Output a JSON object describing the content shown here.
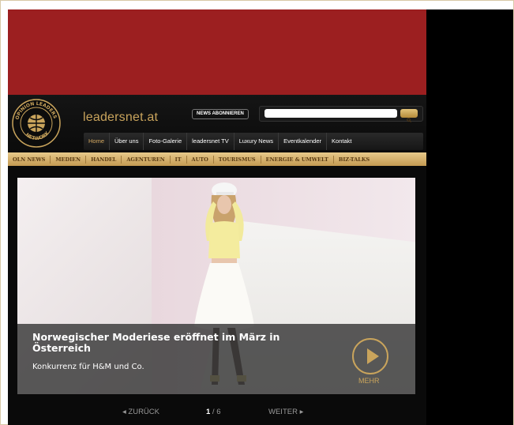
{
  "header": {
    "site_name": "leadersnet.at",
    "news_button": "NEWS ABONNIEREN",
    "search": {
      "value": ""
    },
    "logo": {
      "top_text": "OPINION LEADERS",
      "bottom_text": "NETWORK"
    }
  },
  "mainnav": [
    "Home",
    "Über uns",
    "Foto-Galerie",
    "leadersnet TV",
    "Luxury News",
    "Eventkalender",
    "Kontakt"
  ],
  "categories": [
    "OLN NEWS",
    "MEDIEN",
    "HANDEL",
    "AGENTUREN",
    "IT",
    "AUTO",
    "TOURISMUS",
    "ENERGIE & UMWELT",
    "BIZ-TALKS"
  ],
  "slide": {
    "title": "Norwegischer Moderiese eröffnet im März in Österreich",
    "subtitle": "Konkurrenz für H&M und Co.",
    "more_label": "MEHR"
  },
  "pager": {
    "prev_label": "◂ ZURÜCK",
    "current": "1",
    "total": " / 6",
    "next_label": "WEITER ▸"
  },
  "colors": {
    "ad_banner": "#9c1f20",
    "gold": "#c9a45c",
    "catbar": "#d8b46e"
  }
}
